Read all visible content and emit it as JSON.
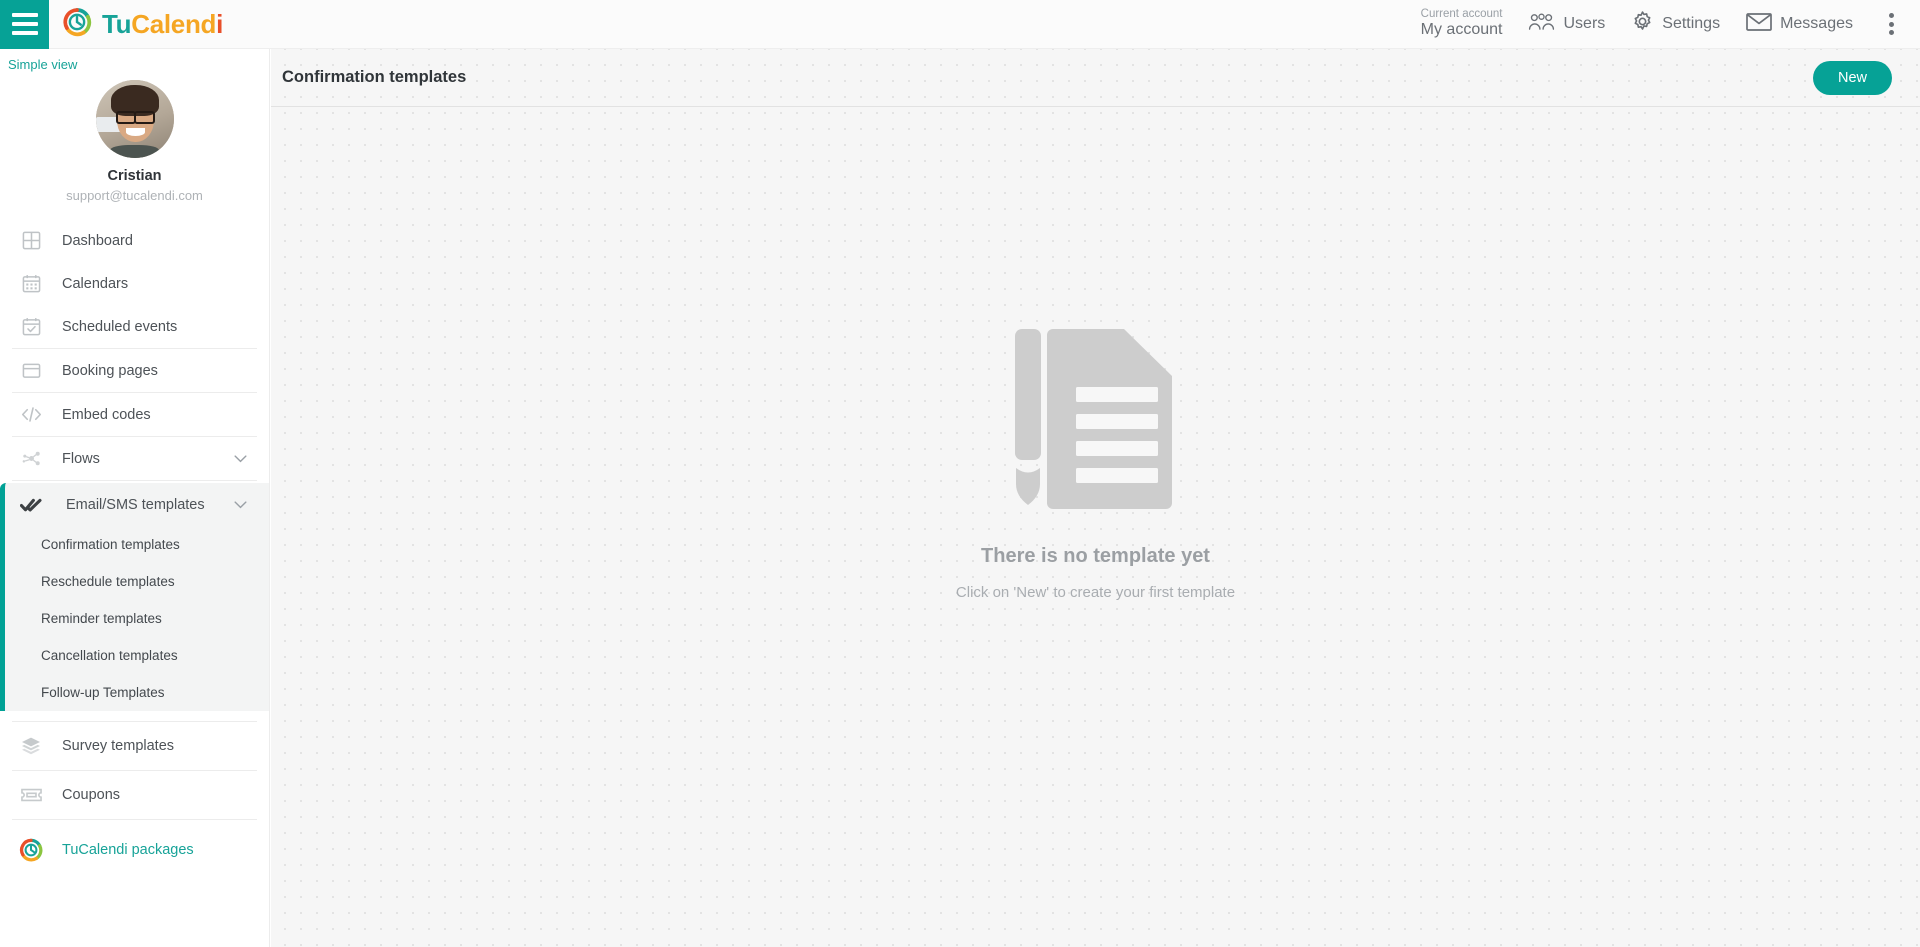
{
  "topbar": {
    "menu_icon": "hamburger-icon",
    "brand": {
      "part1": "Tu",
      "part2": "Calend",
      "part3": "i",
      "logo_icon": "tucalendi-logo-icon"
    },
    "account": {
      "caption": "Current account",
      "name": "My account"
    },
    "items": [
      {
        "label": "Users",
        "icon": "users-icon"
      },
      {
        "label": "Settings",
        "icon": "gear-icon"
      },
      {
        "label": "Messages",
        "icon": "envelope-icon"
      }
    ],
    "overflow_icon": "vertical-dots-icon"
  },
  "sidebar": {
    "simple_view": "Simple view",
    "profile": {
      "name": "Cristian",
      "email": "support@tucalendi.com",
      "avatar": "user-avatar"
    },
    "items": [
      {
        "label": "Dashboard",
        "icon": "dashboard-grid-icon"
      },
      {
        "label": "Calendars",
        "icon": "calendar-icon"
      },
      {
        "label": "Scheduled events",
        "icon": "calendar-check-icon"
      },
      {
        "label": "Booking pages",
        "icon": "window-icon"
      },
      {
        "label": "Embed codes",
        "icon": "code-brackets-icon"
      },
      {
        "label": "Flows",
        "icon": "flow-nodes-icon",
        "chevron": "chevron-down-icon"
      }
    ],
    "active_group": {
      "label": "Email/SMS templates",
      "icon": "double-check-icon",
      "chevron": "chevron-down-icon",
      "subitems": [
        {
          "label": "Confirmation templates",
          "active": true
        },
        {
          "label": "Reschedule templates",
          "active": false
        },
        {
          "label": "Reminder templates",
          "active": false
        },
        {
          "label": "Cancellation templates",
          "active": false
        },
        {
          "label": "Follow-up Templates",
          "active": false
        }
      ]
    },
    "items_after": [
      {
        "label": "Survey templates",
        "icon": "layers-icon"
      },
      {
        "label": "Coupons",
        "icon": "ticket-icon"
      }
    ],
    "packages": {
      "label": "TuCalendi packages",
      "icon": "tucalendi-logo-icon"
    }
  },
  "main": {
    "title": "Confirmation templates",
    "new_button": "New",
    "empty_state": {
      "illustration": "document-with-pen-icon",
      "title": "There is no template yet",
      "subtitle": "Click on 'New' to create your first template"
    }
  },
  "colors": {
    "accent_teal": "#06a296",
    "brand_teal": "#17a398",
    "brand_orange": "#f5a623",
    "brand_red": "#e8502a",
    "brand_green": "#8bc53f",
    "page_bg": "#f6f6f6"
  }
}
